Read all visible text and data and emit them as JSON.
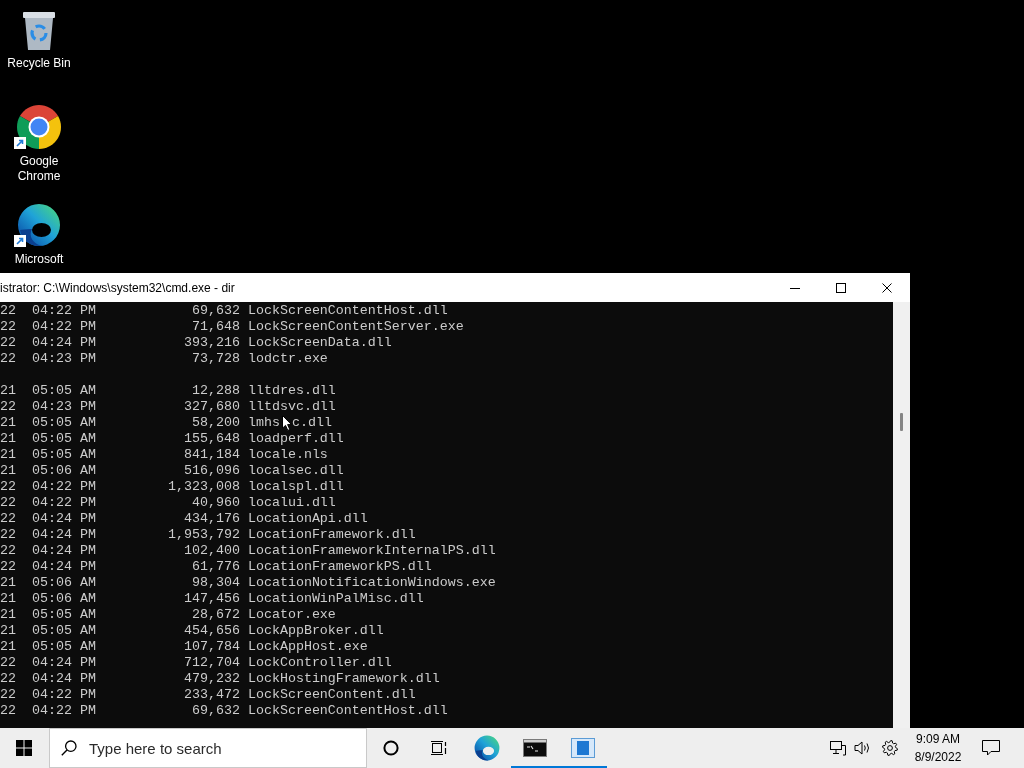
{
  "desktop": {
    "icons": [
      {
        "kind": "bin",
        "label": "Recycle Bin",
        "shortcut": false
      },
      {
        "kind": "ring",
        "label": "Google Chrome",
        "shortcut": true
      },
      {
        "kind": "swirl",
        "label": "Microsoft",
        "shortcut": true
      }
    ]
  },
  "window": {
    "title": "istrator: C:\\Windows\\system32\\cmd.exe - dir",
    "sections": [
      {
        "lines": [
          {
            "date": "22",
            "time": "04:22 PM",
            "size": "69,632",
            "name": "LockScreenContentHost.dll"
          },
          {
            "date": "22",
            "time": "04:22 PM",
            "size": "71,648",
            "name": "LockScreenContentServer.exe"
          },
          {
            "date": "22",
            "time": "04:24 PM",
            "size": "393,216",
            "name": "LockScreenData.dll"
          },
          {
            "date": "22",
            "time": "04:23 PM",
            "size": "73,728",
            "name": "lodctr.exe"
          }
        ]
      },
      {
        "lines": [
          {
            "date": "21",
            "time": "05:05 AM",
            "size": "12,288",
            "name": "lltdres.dll"
          },
          {
            "date": "22",
            "time": "04:23 PM",
            "size": "327,680",
            "name": "lltdsvc.dll"
          },
          {
            "date": "21",
            "time": "05:05 AM",
            "size": "58,200",
            "name": "lmhs",
            "pointer": true,
            "tail": "c.dll"
          },
          {
            "date": "21",
            "time": "05:05 AM",
            "size": "155,648",
            "name": "loadperf.dll"
          },
          {
            "date": "21",
            "time": "05:05 AM",
            "size": "841,184",
            "name": "locale.nls"
          },
          {
            "date": "21",
            "time": "05:06 AM",
            "size": "516,096",
            "name": "localsec.dll"
          },
          {
            "date": "22",
            "time": "04:22 PM",
            "size": "1,323,008",
            "name": "localspl.dll"
          },
          {
            "date": "22",
            "time": "04:22 PM",
            "size": "40,960",
            "name": "localui.dll"
          },
          {
            "date": "22",
            "time": "04:24 PM",
            "size": "434,176",
            "name": "LocationApi.dll"
          },
          {
            "date": "22",
            "time": "04:24 PM",
            "size": "1,953,792",
            "name": "LocationFramework.dll"
          },
          {
            "date": "22",
            "time": "04:24 PM",
            "size": "102,400",
            "name": "LocationFrameworkInternalPS.dll"
          },
          {
            "date": "22",
            "time": "04:24 PM",
            "size": "61,776",
            "name": "LocationFrameworkPS.dll"
          },
          {
            "date": "21",
            "time": "05:06 AM",
            "size": "98,304",
            "name": "LocationNotificationWindows.exe"
          },
          {
            "date": "21",
            "time": "05:06 AM",
            "size": "147,456",
            "name": "LocationWinPalMisc.dll"
          },
          {
            "date": "21",
            "time": "05:05 AM",
            "size": "28,672",
            "name": "Locator.exe"
          },
          {
            "date": "21",
            "time": "05:05 AM",
            "size": "454,656",
            "name": "LockAppBroker.dll"
          },
          {
            "date": "21",
            "time": "05:05 AM",
            "size": "107,784",
            "name": "LockAppHost.exe"
          },
          {
            "date": "22",
            "time": "04:24 PM",
            "size": "712,704",
            "name": "LockController.dll"
          },
          {
            "date": "22",
            "time": "04:24 PM",
            "size": "479,232",
            "name": "LockHostingFramework.dll"
          },
          {
            "date": "22",
            "time": "04:22 PM",
            "size": "233,472",
            "name": "LockScreenContent.dll"
          },
          {
            "date": "22",
            "time": "04:22 PM",
            "size": "69,632",
            "name": "LockScreenContentHost.dll"
          }
        ]
      }
    ]
  },
  "taskbar": {
    "search": {
      "placeholder": "Type here to search"
    },
    "apps": [
      {
        "kind": "swirl",
        "running": false
      },
      {
        "kind": "terminal",
        "running": true
      },
      {
        "kind": "window",
        "running": true
      }
    ],
    "clock": {
      "time": "9:09 AM",
      "date": "8/9/2022"
    }
  }
}
